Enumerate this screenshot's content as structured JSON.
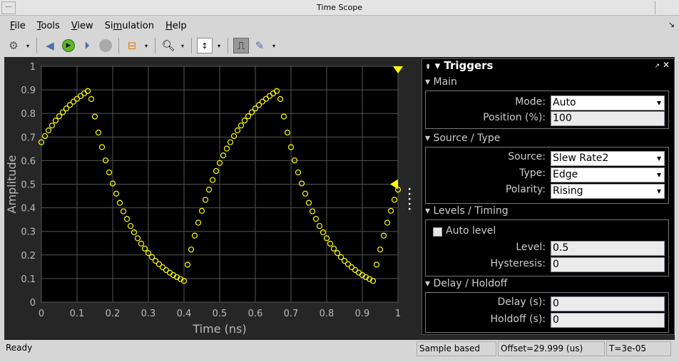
{
  "window": {
    "title": "Time Scope"
  },
  "menu": [
    "File",
    "Tools",
    "View",
    "Simulation",
    "Help"
  ],
  "menu_mnemonic": [
    "F",
    "T",
    "V",
    "m",
    "H"
  ],
  "toolbar": [
    "settings-icon",
    "step-back-icon",
    "run-icon",
    "step-forward-icon",
    "stop-icon",
    "signal-icon",
    "zoom-in-icon",
    "autoscale-icon",
    "trigger-icon",
    "measure-icon"
  ],
  "triggers": {
    "title": "Triggers",
    "main": {
      "header": "Main",
      "mode_label": "Mode:",
      "mode": "Auto",
      "position_label": "Position (%):",
      "position": "100"
    },
    "source": {
      "header": "Source / Type",
      "source_label": "Source:",
      "source": "Slew Rate2",
      "type_label": "Type:",
      "type": "Edge",
      "polarity_label": "Polarity:",
      "polarity": "Rising"
    },
    "levels": {
      "header": "Levels / Timing",
      "auto_level": "Auto level",
      "auto_level_checked": false,
      "level_label": "Level:",
      "level": "0.5",
      "hysteresis_label": "Hysteresis:",
      "hysteresis": "0"
    },
    "delay": {
      "header": "Delay / Holdoff",
      "delay_label": "Delay (s):",
      "delay": "0",
      "holdoff_label": "Holdoff (s):",
      "holdoff": "0"
    }
  },
  "status": {
    "ready": "Ready",
    "mode": "Sample based",
    "offset": "Offset=29.999 (us)",
    "time": "T=3e-05"
  },
  "colors": {
    "trace": "#ffff00",
    "grid": "#555555",
    "axes_bg": "#000000",
    "figure_bg": "#262626"
  },
  "chart_data": {
    "type": "scatter",
    "xlabel": "Time (ns)",
    "ylabel": "Amplitude",
    "xlim": [
      0,
      1
    ],
    "ylim": [
      0,
      1
    ],
    "grid": true,
    "xticks": [
      "0",
      "0.1",
      "0.2",
      "0.3",
      "0.4",
      "0.5",
      "0.6",
      "0.7",
      "0.8",
      "0.9",
      "1"
    ],
    "yticks": [
      "0",
      "0.1",
      "0.2",
      "0.3",
      "0.4",
      "0.5",
      "0.6",
      "0.7",
      "0.8",
      "0.9",
      "1"
    ],
    "trigger_level": 0.5,
    "trigger_position": 1,
    "x_start": 0,
    "x_step": 0.01,
    "y": [
      0.678,
      0.704,
      0.728,
      0.749,
      0.77,
      0.788,
      0.805,
      0.821,
      0.836,
      0.85,
      0.862,
      0.874,
      0.885,
      0.895,
      0.861,
      0.787,
      0.719,
      0.657,
      0.601,
      0.55,
      0.503,
      0.46,
      0.421,
      0.385,
      0.353,
      0.323,
      0.296,
      0.271,
      0.248,
      0.227,
      0.208,
      0.191,
      0.175,
      0.161,
      0.148,
      0.136,
      0.125,
      0.115,
      0.106,
      0.098,
      0.09,
      0.159,
      0.223,
      0.282,
      0.337,
      0.387,
      0.434,
      0.477,
      0.518,
      0.556,
      0.59,
      0.622,
      0.651,
      0.678,
      0.704,
      0.728,
      0.749,
      0.77,
      0.788,
      0.805,
      0.821,
      0.836,
      0.85,
      0.862,
      0.874,
      0.885,
      0.895,
      0.861,
      0.787,
      0.719,
      0.657,
      0.601,
      0.55,
      0.503,
      0.46,
      0.421,
      0.385,
      0.353,
      0.323,
      0.296,
      0.271,
      0.248,
      0.227,
      0.208,
      0.191,
      0.175,
      0.161,
      0.148,
      0.136,
      0.125,
      0.115,
      0.106,
      0.098,
      0.09,
      0.159,
      0.223,
      0.282,
      0.337,
      0.387,
      0.434,
      0.477
    ]
  }
}
